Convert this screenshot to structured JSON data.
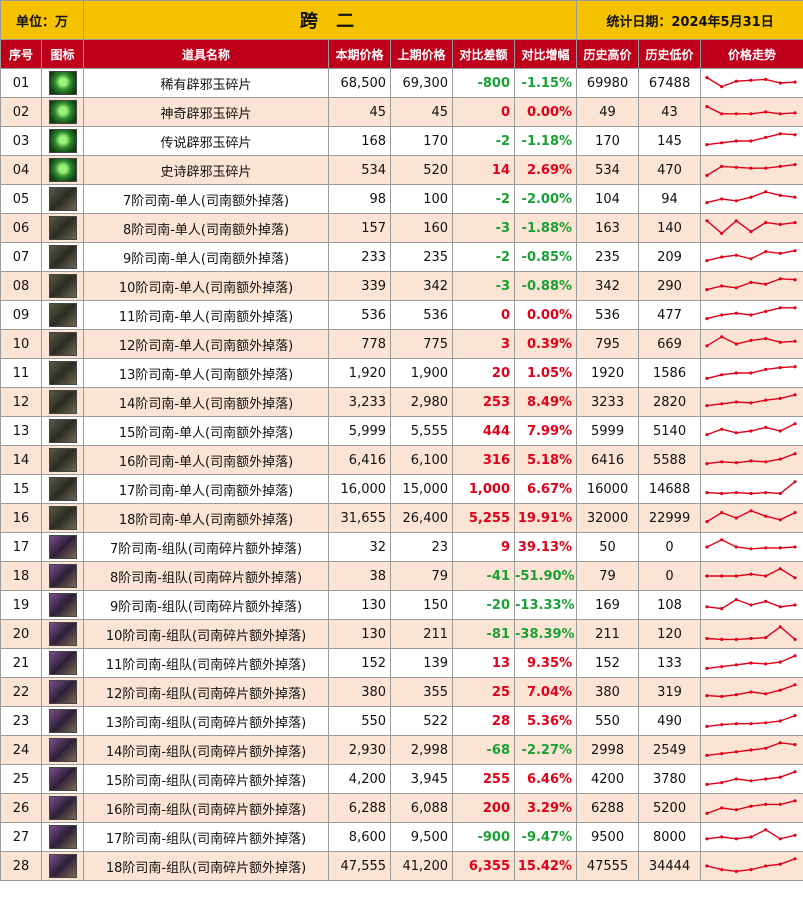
{
  "header": {
    "unit": "单位：万",
    "title": "跨 二",
    "date": "统计日期：2024年5月31日"
  },
  "columns": [
    "序号",
    "图标",
    "道具名称",
    "本期价格",
    "上期价格",
    "对比差额",
    "对比增幅",
    "历史高价",
    "历史低价",
    "价格走势"
  ],
  "colors": {
    "header_yellow": "#f5c200",
    "header_red": "#c0001a",
    "row_alt": "#fbe4d4",
    "up": "#e0001a",
    "down": "#1aa035",
    "spark": "#e0001a"
  },
  "rows": [
    {
      "no": "01",
      "icon": "green-jade-icon",
      "name": "稀有辟邪玉碎片",
      "cur": "68,500",
      "prev": "69,300",
      "diff": "-800",
      "pct": "-1.15%",
      "high": "69980",
      "low": "67488",
      "trend": [
        0.8,
        0.3,
        0.6,
        0.65,
        0.7,
        0.5,
        0.55
      ]
    },
    {
      "no": "02",
      "icon": "green-jade-icon",
      "name": "神奇辟邪玉碎片",
      "cur": "45",
      "prev": "45",
      "diff": "0",
      "pct": "0.00%",
      "high": "49",
      "low": "43",
      "trend": [
        0.8,
        0.4,
        0.4,
        0.4,
        0.5,
        0.4,
        0.45
      ]
    },
    {
      "no": "03",
      "icon": "green-jade-icon",
      "name": "传说辟邪玉碎片",
      "cur": "168",
      "prev": "170",
      "diff": "-2",
      "pct": "-1.18%",
      "high": "170",
      "low": "145",
      "trend": [
        0.3,
        0.4,
        0.5,
        0.5,
        0.7,
        0.9,
        0.85
      ]
    },
    {
      "no": "04",
      "icon": "green-jade-icon",
      "name": "史诗辟邪玉碎片",
      "cur": "534",
      "prev": "520",
      "diff": "14",
      "pct": "2.69%",
      "high": "534",
      "low": "470",
      "trend": [
        0.2,
        0.7,
        0.65,
        0.6,
        0.6,
        0.7,
        0.8
      ]
    },
    {
      "no": "05",
      "icon": "dark-fish-icon",
      "name": "7阶司南-单人(司南额外掉落)",
      "cur": "98",
      "prev": "100",
      "diff": "-2",
      "pct": "-2.00%",
      "high": "104",
      "low": "94",
      "trend": [
        0.3,
        0.5,
        0.4,
        0.6,
        0.9,
        0.7,
        0.6
      ]
    },
    {
      "no": "06",
      "icon": "dark-fish-icon",
      "name": "8阶司南-单人(司南额外掉落)",
      "cur": "157",
      "prev": "160",
      "diff": "-3",
      "pct": "-1.88%",
      "high": "163",
      "low": "140",
      "trend": [
        0.9,
        0.2,
        0.9,
        0.3,
        0.8,
        0.7,
        0.8
      ]
    },
    {
      "no": "07",
      "icon": "dark-fish-icon",
      "name": "9阶司南-单人(司南额外掉落)",
      "cur": "233",
      "prev": "235",
      "diff": "-2",
      "pct": "-0.85%",
      "high": "235",
      "low": "209",
      "trend": [
        0.3,
        0.5,
        0.6,
        0.4,
        0.8,
        0.7,
        0.85
      ]
    },
    {
      "no": "08",
      "icon": "dark-fish-icon",
      "name": "10阶司南-单人(司南额外掉落)",
      "cur": "339",
      "prev": "342",
      "diff": "-3",
      "pct": "-0.88%",
      "high": "342",
      "low": "290",
      "trend": [
        0.3,
        0.5,
        0.4,
        0.7,
        0.6,
        0.9,
        0.85
      ]
    },
    {
      "no": "09",
      "icon": "dark-fish-icon",
      "name": "11阶司南-单人(司南额外掉落)",
      "cur": "536",
      "prev": "536",
      "diff": "0",
      "pct": "0.00%",
      "high": "536",
      "low": "477",
      "trend": [
        0.3,
        0.5,
        0.6,
        0.5,
        0.7,
        0.9,
        0.9
      ]
    },
    {
      "no": "10",
      "icon": "dark-fish-icon",
      "name": "12阶司南-单人(司南额外掉落)",
      "cur": "778",
      "prev": "775",
      "diff": "3",
      "pct": "0.39%",
      "high": "795",
      "low": "669",
      "trend": [
        0.4,
        0.9,
        0.5,
        0.7,
        0.8,
        0.6,
        0.65
      ]
    },
    {
      "no": "11",
      "icon": "dark-fish-icon",
      "name": "13阶司南-单人(司南额外掉落)",
      "cur": "1,920",
      "prev": "1,900",
      "diff": "20",
      "pct": "1.05%",
      "high": "1920",
      "low": "1586",
      "trend": [
        0.2,
        0.4,
        0.5,
        0.5,
        0.7,
        0.8,
        0.85
      ]
    },
    {
      "no": "12",
      "icon": "dark-fish-icon",
      "name": "14阶司南-单人(司南额外掉落)",
      "cur": "3,233",
      "prev": "2,980",
      "diff": "253",
      "pct": "8.49%",
      "high": "3233",
      "low": "2820",
      "trend": [
        0.3,
        0.4,
        0.5,
        0.45,
        0.6,
        0.7,
        0.9
      ]
    },
    {
      "no": "13",
      "icon": "dark-fish-icon",
      "name": "15阶司南-单人(司南额外掉落)",
      "cur": "5,999",
      "prev": "5,555",
      "diff": "444",
      "pct": "7.99%",
      "high": "5999",
      "low": "5140",
      "trend": [
        0.3,
        0.6,
        0.4,
        0.5,
        0.7,
        0.5,
        0.9
      ]
    },
    {
      "no": "14",
      "icon": "dark-fish-icon",
      "name": "16阶司南-单人(司南额外掉落)",
      "cur": "6,416",
      "prev": "6,100",
      "diff": "316",
      "pct": "5.18%",
      "high": "6416",
      "low": "5588",
      "trend": [
        0.3,
        0.4,
        0.35,
        0.45,
        0.4,
        0.55,
        0.85
      ]
    },
    {
      "no": "15",
      "icon": "dark-fish-icon",
      "name": "17阶司南-单人(司南额外掉落)",
      "cur": "16,000",
      "prev": "15,000",
      "diff": "1,000",
      "pct": "6.67%",
      "high": "16000",
      "low": "14688",
      "trend": [
        0.3,
        0.25,
        0.3,
        0.25,
        0.3,
        0.25,
        0.9
      ]
    },
    {
      "no": "16",
      "icon": "dark-fish-icon",
      "name": "18阶司南-单人(司南额外掉落)",
      "cur": "31,655",
      "prev": "26,400",
      "diff": "5,255",
      "pct": "19.91%",
      "high": "32000",
      "low": "22999",
      "trend": [
        0.3,
        0.8,
        0.5,
        0.9,
        0.6,
        0.4,
        0.8
      ]
    },
    {
      "no": "17",
      "icon": "purple-fish-icon",
      "name": "7阶司南-组队(司南碎片额外掉落)",
      "cur": "32",
      "prev": "23",
      "diff": "9",
      "pct": "39.13%",
      "high": "50",
      "low": "0",
      "trend": [
        0.5,
        0.9,
        0.5,
        0.4,
        0.45,
        0.45,
        0.5
      ]
    },
    {
      "no": "18",
      "icon": "purple-fish-icon",
      "name": "8阶司南-组队(司南碎片额外掉落)",
      "cur": "38",
      "prev": "79",
      "diff": "-41",
      "pct": "-51.90%",
      "high": "79",
      "low": "0",
      "trend": [
        0.5,
        0.5,
        0.5,
        0.6,
        0.5,
        0.9,
        0.4
      ]
    },
    {
      "no": "19",
      "icon": "purple-fish-icon",
      "name": "9阶司南-组队(司南碎片额外掉落)",
      "cur": "130",
      "prev": "150",
      "diff": "-20",
      "pct": "-13.33%",
      "high": "169",
      "low": "108",
      "trend": [
        0.4,
        0.3,
        0.8,
        0.5,
        0.7,
        0.4,
        0.5
      ]
    },
    {
      "no": "20",
      "icon": "purple-fish-icon",
      "name": "10阶司南-组队(司南碎片额外掉落)",
      "cur": "130",
      "prev": "211",
      "diff": "-81",
      "pct": "-38.39%",
      "high": "211",
      "low": "120",
      "trend": [
        0.25,
        0.2,
        0.2,
        0.25,
        0.3,
        0.9,
        0.2
      ]
    },
    {
      "no": "21",
      "icon": "purple-fish-icon",
      "name": "11阶司南-组队(司南碎片额外掉落)",
      "cur": "152",
      "prev": "139",
      "diff": "13",
      "pct": "9.35%",
      "high": "152",
      "low": "133",
      "trend": [
        0.2,
        0.3,
        0.4,
        0.5,
        0.45,
        0.55,
        0.9
      ]
    },
    {
      "no": "22",
      "icon": "purple-fish-icon",
      "name": "12阶司南-组队(司南碎片额外掉落)",
      "cur": "380",
      "prev": "355",
      "diff": "25",
      "pct": "7.04%",
      "high": "380",
      "low": "319",
      "trend": [
        0.3,
        0.25,
        0.35,
        0.5,
        0.4,
        0.6,
        0.9
      ]
    },
    {
      "no": "23",
      "icon": "purple-fish-icon",
      "name": "13阶司南-组队(司南碎片额外掉落)",
      "cur": "550",
      "prev": "522",
      "diff": "28",
      "pct": "5.36%",
      "high": "550",
      "low": "490",
      "trend": [
        0.2,
        0.3,
        0.35,
        0.35,
        0.4,
        0.5,
        0.8
      ]
    },
    {
      "no": "24",
      "icon": "purple-fish-icon",
      "name": "14阶司南-组队(司南碎片额外掉落)",
      "cur": "2,930",
      "prev": "2,998",
      "diff": "-68",
      "pct": "-2.27%",
      "high": "2998",
      "low": "2549",
      "trend": [
        0.2,
        0.3,
        0.4,
        0.5,
        0.6,
        0.9,
        0.8
      ]
    },
    {
      "no": "25",
      "icon": "purple-fish-icon",
      "name": "15阶司南-组队(司南碎片额外掉落)",
      "cur": "4,200",
      "prev": "3,945",
      "diff": "255",
      "pct": "6.46%",
      "high": "4200",
      "low": "3780",
      "trend": [
        0.2,
        0.3,
        0.5,
        0.4,
        0.5,
        0.6,
        0.9
      ]
    },
    {
      "no": "26",
      "icon": "purple-fish-icon",
      "name": "16阶司南-组队(司南碎片额外掉落)",
      "cur": "6,288",
      "prev": "6,088",
      "diff": "200",
      "pct": "3.29%",
      "high": "6288",
      "low": "5200",
      "trend": [
        0.2,
        0.5,
        0.4,
        0.6,
        0.7,
        0.7,
        0.9
      ]
    },
    {
      "no": "27",
      "icon": "purple-fish-icon",
      "name": "17阶司南-组队(司南碎片额外掉落)",
      "cur": "8,600",
      "prev": "9,500",
      "diff": "-900",
      "pct": "-9.47%",
      "high": "9500",
      "low": "8000",
      "trend": [
        0.4,
        0.5,
        0.4,
        0.5,
        0.9,
        0.4,
        0.6
      ]
    },
    {
      "no": "28",
      "icon": "purple-fish-icon",
      "name": "18阶司南-组队(司南碎片额外掉落)",
      "cur": "47,555",
      "prev": "41,200",
      "diff": "6,355",
      "pct": "15.42%",
      "high": "47555",
      "low": "34444",
      "trend": [
        0.5,
        0.3,
        0.2,
        0.3,
        0.5,
        0.6,
        0.9
      ]
    }
  ]
}
